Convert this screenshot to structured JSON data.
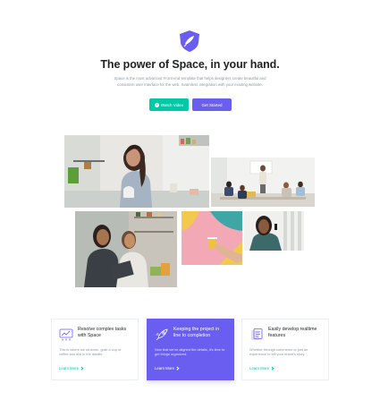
{
  "hero": {
    "title": "The power of Space, in your hand.",
    "description": "Space is the most advanced Front-end template that helps designers create beautiful and consistent user interface for the web. Seamless integration with your existing website.",
    "watch_label": "Watch Video",
    "start_label": "Get Started"
  },
  "colors": {
    "brand": "#6a5ef0",
    "accent": "#00c9a7"
  },
  "cards": [
    {
      "icon": "team-chart-icon",
      "title": "Resolve complex tasks with Space",
      "text": "This is where we sit down, grab a cup of coffee and dial in the details.",
      "link": "Learn More"
    },
    {
      "icon": "rocket-icon",
      "title": "Keeping the project in line to completion",
      "text": "Now that we've aligned the details, it's time to get things organized.",
      "link": "Learn More"
    },
    {
      "icon": "document-stack-icon",
      "title": "Easily develop realtime features",
      "text": "Whether through commerce or just an experience to tell your brand's story.",
      "link": "Learn More"
    }
  ]
}
